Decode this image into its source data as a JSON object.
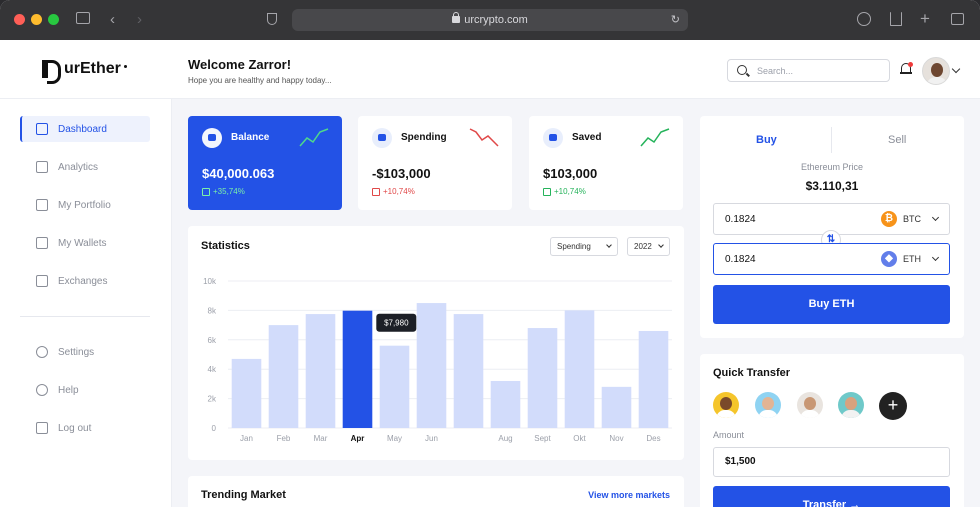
{
  "browser": {
    "url": "urcrypto.com"
  },
  "brand": {
    "name": "urEther"
  },
  "header": {
    "title": "Welcome Zarror!",
    "subtitle": "Hope you are healthy and happy today...",
    "search_placeholder": "Search..."
  },
  "sidebar": {
    "items": [
      {
        "label": "Dashboard",
        "icon": "home-icon",
        "active": true
      },
      {
        "label": "Analytics",
        "icon": "analytics-icon",
        "active": false
      },
      {
        "label": "My Portfolio",
        "icon": "portfolio-icon",
        "active": false
      },
      {
        "label": "My Wallets",
        "icon": "wallet-icon",
        "active": false
      },
      {
        "label": "Exchanges",
        "icon": "exchange-icon",
        "active": false
      }
    ],
    "footer_items": [
      {
        "label": "Settings",
        "icon": "gear-icon"
      },
      {
        "label": "Help",
        "icon": "info-icon"
      },
      {
        "label": "Log out",
        "icon": "logout-icon"
      }
    ]
  },
  "cards": [
    {
      "label": "Balance",
      "value": "$40,000.063",
      "change": "+35,74%",
      "trend": "up",
      "color": "#2352e6"
    },
    {
      "label": "Spending",
      "value": "-$103,000",
      "change": "+10,74%",
      "trend": "down",
      "color": "#e04848"
    },
    {
      "label": "Saved",
      "value": "$103,000",
      "change": "+10,74%",
      "trend": "up",
      "color": "#25b35b"
    }
  ],
  "statistics": {
    "title": "Statistics",
    "filter": "Spending",
    "year": "2022",
    "tooltip": "$7,980"
  },
  "chart_data": {
    "type": "bar",
    "categories": [
      "Jan",
      "Feb",
      "Mar",
      "Apr",
      "May",
      "Jun",
      "Aug",
      "Sept",
      "Okt",
      "Nov",
      "Des"
    ],
    "values": [
      4700,
      7000,
      7750,
      7980,
      5600,
      8500,
      7750,
      3200,
      6800,
      8000,
      2800,
      6600
    ],
    "ylim": [
      0,
      10000
    ],
    "yticks": [
      "10k",
      "8k",
      "6k",
      "4k",
      "2k",
      "0"
    ],
    "highlight": "Apr",
    "bar_color": "#d2dcfb",
    "highlight_color": "#2352e6"
  },
  "trending": {
    "title": "Trending Market",
    "link": "View more markets"
  },
  "trade": {
    "tabs": [
      "Buy",
      "Sell"
    ],
    "price_label": "Ethereum Price",
    "price": "$3.110,31",
    "from_amount": "0.1824",
    "from_currency": "BTC",
    "to_amount": "0.1824",
    "to_currency": "ETH",
    "button": "Buy ETH"
  },
  "quick_transfer": {
    "title": "Quick Transfer",
    "amount_label": "Amount",
    "amount": "$1,500",
    "button": "Transfer"
  }
}
